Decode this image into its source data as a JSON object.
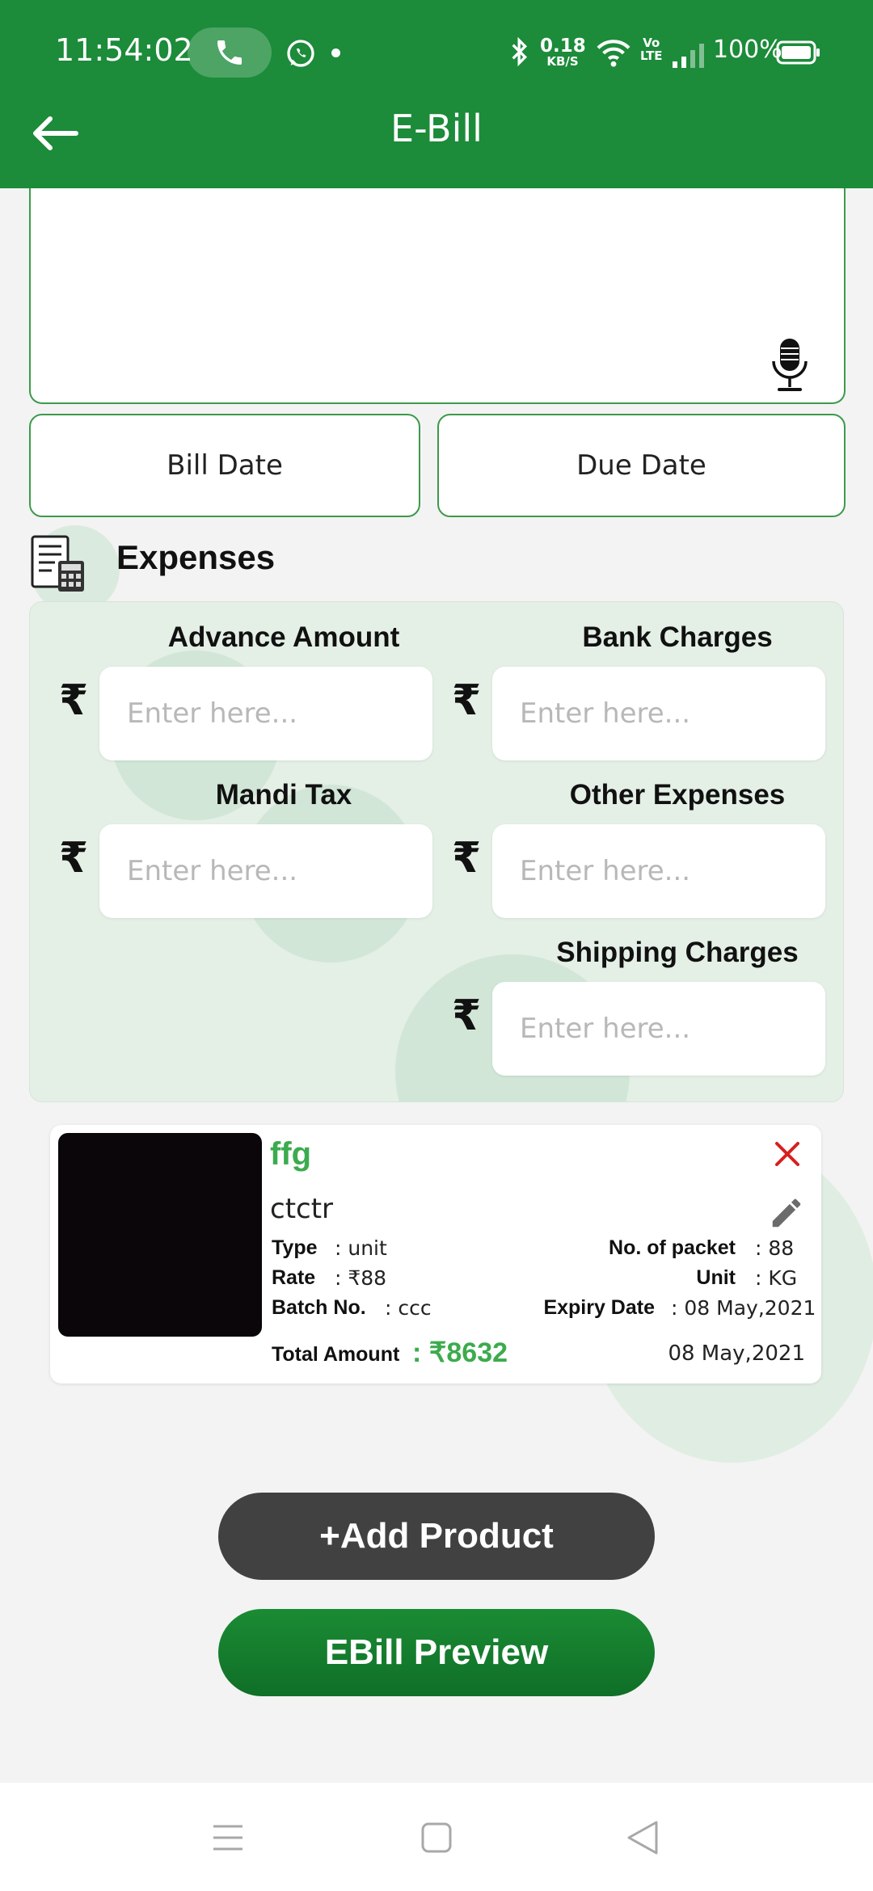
{
  "status_bar": {
    "time": "11:54:02",
    "net_speed_value": "0.18",
    "net_speed_unit": "KB/S",
    "volte_top": "Vo",
    "volte_bottom": "LTE",
    "battery": "100%"
  },
  "app_bar": {
    "title": "E-Bill"
  },
  "dates": {
    "bill_date_label": "Bill Date",
    "due_date_label": "Due Date"
  },
  "expenses": {
    "title": "Expenses",
    "currency_symbol": "₹",
    "placeholder": "Enter here...",
    "advance_amount_label": "Advance Amount",
    "bank_charges_label": "Bank Charges",
    "mandi_tax_label": "Mandi Tax",
    "other_expenses_label": "Other Expenses",
    "shipping_charges_label": "Shipping Charges"
  },
  "product": {
    "name": "ffg",
    "description": "ctctr",
    "type_label": "Type",
    "type_value": ": unit",
    "rate_label": "Rate",
    "rate_value": ": ₹88",
    "batch_label": "Batch No.",
    "batch_value": ": ccc",
    "packets_label": "No. of packet",
    "packets_value": ": 88",
    "unit_label": "Unit",
    "unit_value": ": KG",
    "expiry_label": "Expiry Date",
    "expiry_value": ": 08 May,2021",
    "total_label": "Total Amount",
    "total_value": ": ₹8632",
    "date": "08 May,2021"
  },
  "actions": {
    "add_product": "+Add Product",
    "preview": "EBill Preview"
  },
  "colors": {
    "primary": "#1c8b3a",
    "accent_green": "#3cab4d",
    "dark_button": "#414141",
    "delete_red": "#d71f1f"
  }
}
